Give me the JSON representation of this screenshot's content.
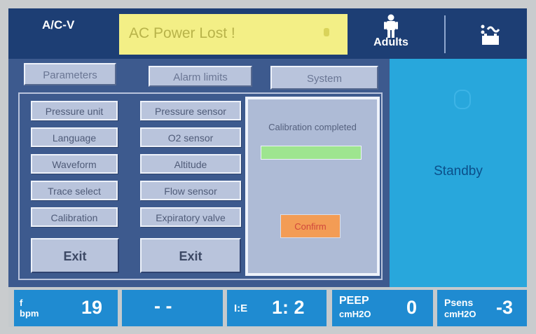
{
  "header": {
    "mode": "A/C-V",
    "alarm_message": "AC Power Lost !",
    "patient_type": "Adults"
  },
  "tabs": {
    "parameters": "Parameters",
    "alarm_limits": "Alarm limits",
    "system": "System"
  },
  "system_menu": {
    "items": [
      "Pressure unit",
      "Language",
      "Waveform",
      "Trace select",
      "Calibration"
    ],
    "exit": "Exit"
  },
  "calibration_menu": {
    "items": [
      "Pressure sensor",
      "O2 sensor",
      "Altitude",
      "Flow sensor",
      "Expiratory valve"
    ],
    "exit": "Exit"
  },
  "calibration_dialog": {
    "message": "Calibration completed",
    "progress_percent": 100,
    "confirm": "Confirm"
  },
  "status": {
    "standby": "Standby"
  },
  "footer": {
    "f_label": "f",
    "f_unit": "bpm",
    "f_value": "19",
    "blank_value": "- -",
    "ie_label": "I:E",
    "ie_value": "1: 2",
    "peep_label": "PEEP",
    "peep_unit": "cmH2O",
    "peep_value": "0",
    "psens_label": "Psens",
    "psens_unit": "cmH2O",
    "psens_value": "-3"
  },
  "colors": {
    "panel": "#3d5a8e",
    "top_bar": "#1d3e74",
    "alarm_bg": "#f3ef86",
    "standby_bg": "#28a7dc",
    "confirm_bg": "#f39c55",
    "progress_fill": "#9ee58f",
    "bottom_cell": "#1f8bd1"
  },
  "icons": {
    "patient": "adult-figure-icon",
    "power": "ac-battery-icon",
    "standby": "standby-indicator-icon"
  }
}
